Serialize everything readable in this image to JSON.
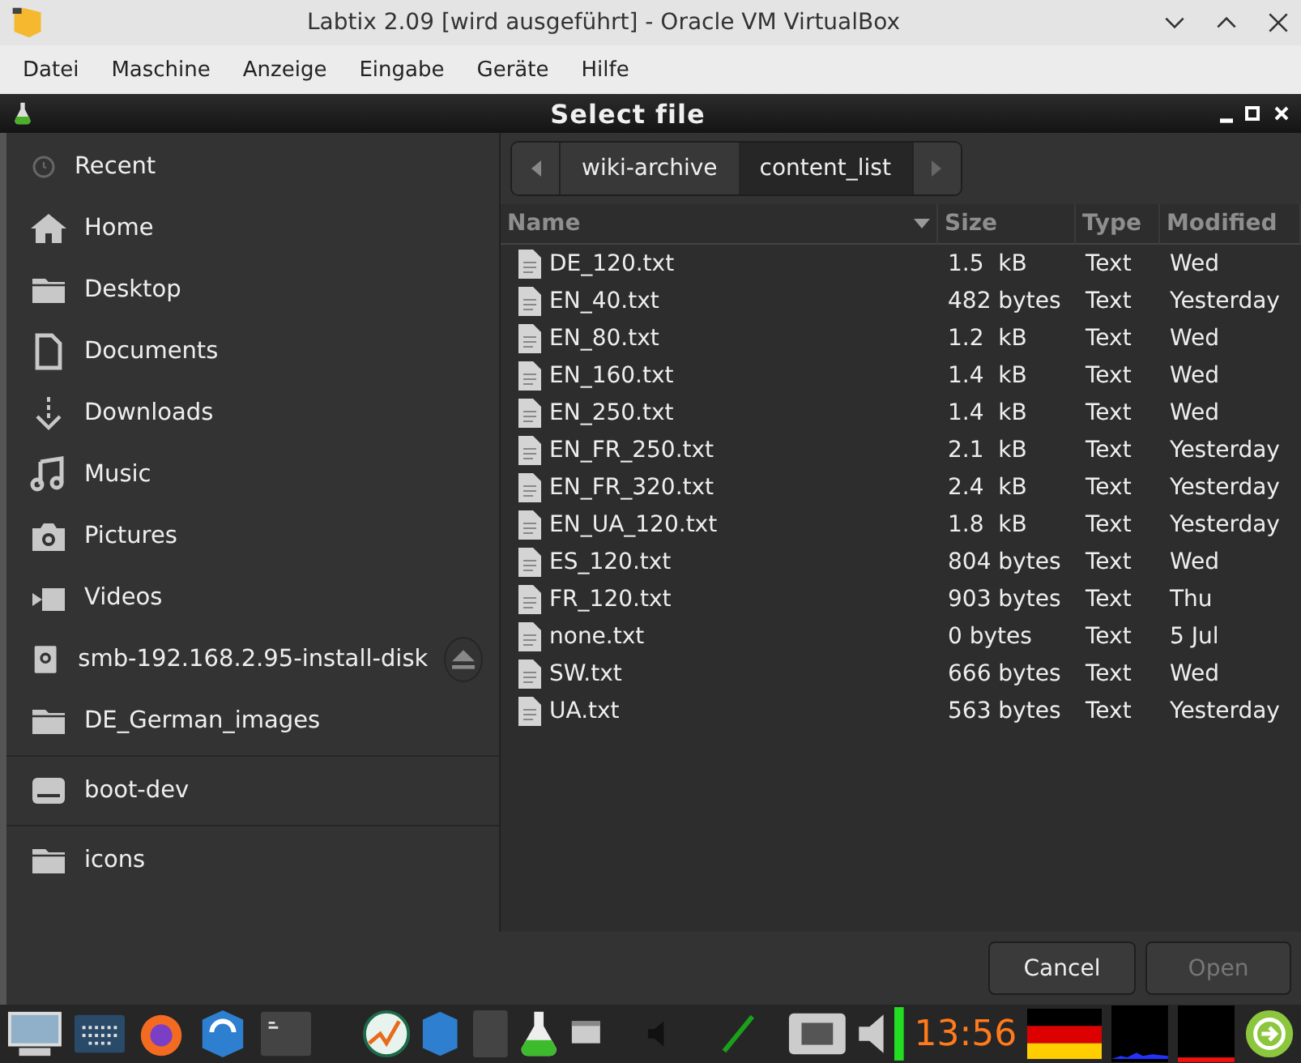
{
  "window": {
    "title": "Labtix 2.09 [wird ausgeführt] - Oracle VM VirtualBox"
  },
  "menu": [
    "Datei",
    "Maschine",
    "Anzeige",
    "Eingabe",
    "Geräte",
    "Hilfe"
  ],
  "dialog": {
    "title": "Select file"
  },
  "sidebar": {
    "groups": [
      {
        "items": [
          {
            "label": "Recent",
            "kind": "place"
          },
          {
            "label": "Home",
            "kind": "place"
          },
          {
            "label": "Desktop",
            "kind": "place"
          },
          {
            "label": "Documents",
            "kind": "place"
          },
          {
            "label": "Downloads",
            "kind": "place"
          },
          {
            "label": "Music",
            "kind": "place"
          },
          {
            "label": "Pictures",
            "kind": "place"
          },
          {
            "label": "Videos",
            "kind": "place"
          },
          {
            "label": "smb-192.168.2.95-install-disk",
            "kind": "mount"
          },
          {
            "label": "DE_German_images",
            "kind": "place"
          }
        ]
      },
      {
        "items": [
          {
            "label": "boot-dev",
            "kind": "drive"
          }
        ]
      },
      {
        "items": [
          {
            "label": "icons",
            "kind": "place"
          }
        ]
      }
    ]
  },
  "path": [
    {
      "label": "wiki-archive",
      "selected": false
    },
    {
      "label": "content_list",
      "selected": true
    }
  ],
  "table": {
    "columns": [
      "Name",
      "Size",
      "Type",
      "Modified"
    ],
    "rows": [
      [
        "DE_120.txt",
        "1.5  kB",
        "Text",
        "Wed"
      ],
      [
        "EN_40.txt",
        "482 bytes",
        "Text",
        "Yesterday"
      ],
      [
        "EN_80.txt",
        "1.2  kB",
        "Text",
        "Wed"
      ],
      [
        "EN_160.txt",
        "1.4  kB",
        "Text",
        "Wed"
      ],
      [
        "EN_250.txt",
        "1.4  kB",
        "Text",
        "Wed"
      ],
      [
        "EN_FR_250.txt",
        "2.1  kB",
        "Text",
        "Yesterday"
      ],
      [
        "EN_FR_320.txt",
        "2.4  kB",
        "Text",
        "Yesterday"
      ],
      [
        "EN_UA_120.txt",
        "1.8  kB",
        "Text",
        "Yesterday"
      ],
      [
        "ES_120.txt",
        "804 bytes",
        "Text",
        "Wed"
      ],
      [
        "FR_120.txt",
        "903 bytes",
        "Text",
        "Thu"
      ],
      [
        "none.txt",
        "0 bytes",
        "Text",
        "5 Jul"
      ],
      [
        "SW.txt",
        "666 bytes",
        "Text",
        "Wed"
      ],
      [
        "UA.txt",
        "563 bytes",
        "Text",
        "Yesterday"
      ]
    ]
  },
  "buttons": [
    {
      "label": "Cancel",
      "disabled": false
    },
    {
      "label": "Open",
      "disabled": true
    }
  ],
  "taskbar": {
    "clock": "13:56"
  }
}
